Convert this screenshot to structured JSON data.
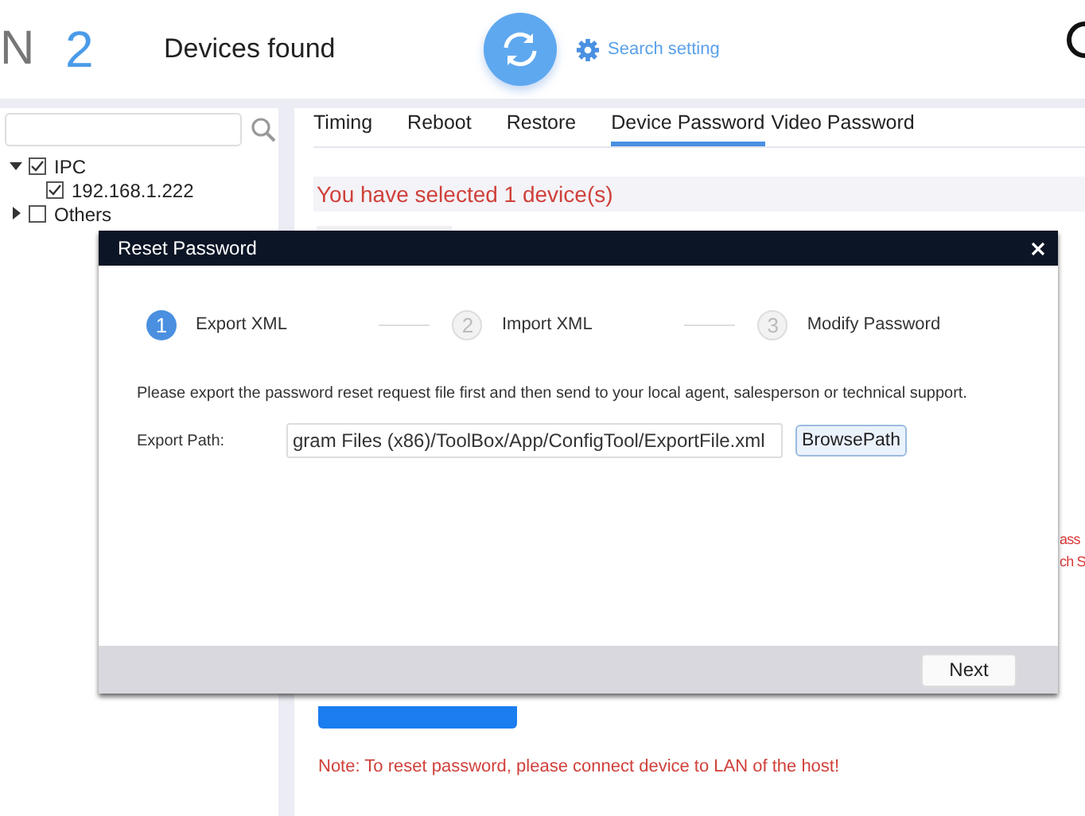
{
  "header": {
    "brand_fragment": "N",
    "count": "2",
    "title": "Devices found",
    "search_setting": "Search setting"
  },
  "tree": [
    {
      "label": "IPC",
      "expanded": true,
      "checked": true,
      "children": [
        {
          "label": "192.168.1.222",
          "checked": true
        }
      ]
    },
    {
      "label": "Others",
      "expanded": false,
      "checked": false
    }
  ],
  "tabs": [
    {
      "label": "Timing",
      "selected": false
    },
    {
      "label": "Reboot",
      "selected": false
    },
    {
      "label": "Restore",
      "selected": false
    },
    {
      "label": "Device Password",
      "selected": true
    },
    {
      "label": "Video Password",
      "selected": false
    }
  ],
  "selection_message": "You have selected 1 device(s)",
  "covered_fragments": [
    "ass",
    "ch S"
  ],
  "note": "Note: To reset password, please connect device to LAN of the host!",
  "dialog": {
    "title": "Reset Password",
    "steps": [
      {
        "number": "1",
        "label": "Export XML",
        "active": true
      },
      {
        "number": "2",
        "label": "Import XML",
        "active": false
      },
      {
        "number": "3",
        "label": "Modify Password",
        "active": false
      }
    ],
    "instruction": "Please export the password reset request file first and then send to your local agent, salesperson or technical support.",
    "export_path": {
      "label": "Export Path:",
      "value": "gram Files (x86)/ToolBox/App/ConfigTool/ExportFile.xml"
    },
    "browse_button": "BrowsePath",
    "next_button": "Next"
  }
}
